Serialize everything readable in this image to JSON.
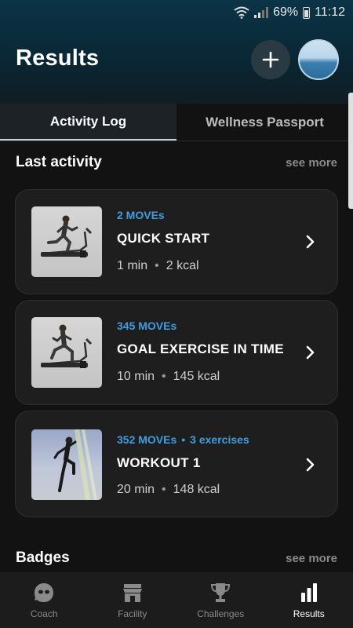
{
  "status_bar": {
    "battery": "69%",
    "time": "11:12"
  },
  "header": {
    "title": "Results",
    "add_icon": "plus-icon",
    "avatar_icon": "profile-avatar"
  },
  "tabs": [
    {
      "label": "Activity Log",
      "active": true
    },
    {
      "label": "Wellness Passport",
      "active": false
    }
  ],
  "last_activity": {
    "title": "Last activity",
    "see_more": "see more",
    "items": [
      {
        "moves": "2 MOVEs",
        "extra": "",
        "name": "QUICK START",
        "duration": "1 min",
        "kcal": "2 kcal",
        "thumb": "treadmill-runner"
      },
      {
        "moves": "345 MOVEs",
        "extra": "",
        "name": "GOAL EXERCISE IN TIME",
        "duration": "10 min",
        "kcal": "145 kcal",
        "thumb": "treadmill-runner"
      },
      {
        "moves": "352 MOVEs",
        "extra": "3 exercises",
        "name": "WORKOUT 1",
        "duration": "20 min",
        "kcal": "148 kcal",
        "thumb": "workout-athlete"
      }
    ]
  },
  "badges": {
    "title": "Badges",
    "see_more": "see more"
  },
  "bottom_nav": [
    {
      "label": "Coach",
      "icon": "coach-face-icon",
      "active": false
    },
    {
      "label": "Facility",
      "icon": "facility-store-icon",
      "active": false
    },
    {
      "label": "Challenges",
      "icon": "trophy-icon",
      "active": false
    },
    {
      "label": "Results",
      "icon": "bar-chart-icon",
      "active": true
    }
  ],
  "colors": {
    "accent": "#3d9fe0",
    "background": "#121212",
    "card": "#1e1e1e"
  }
}
